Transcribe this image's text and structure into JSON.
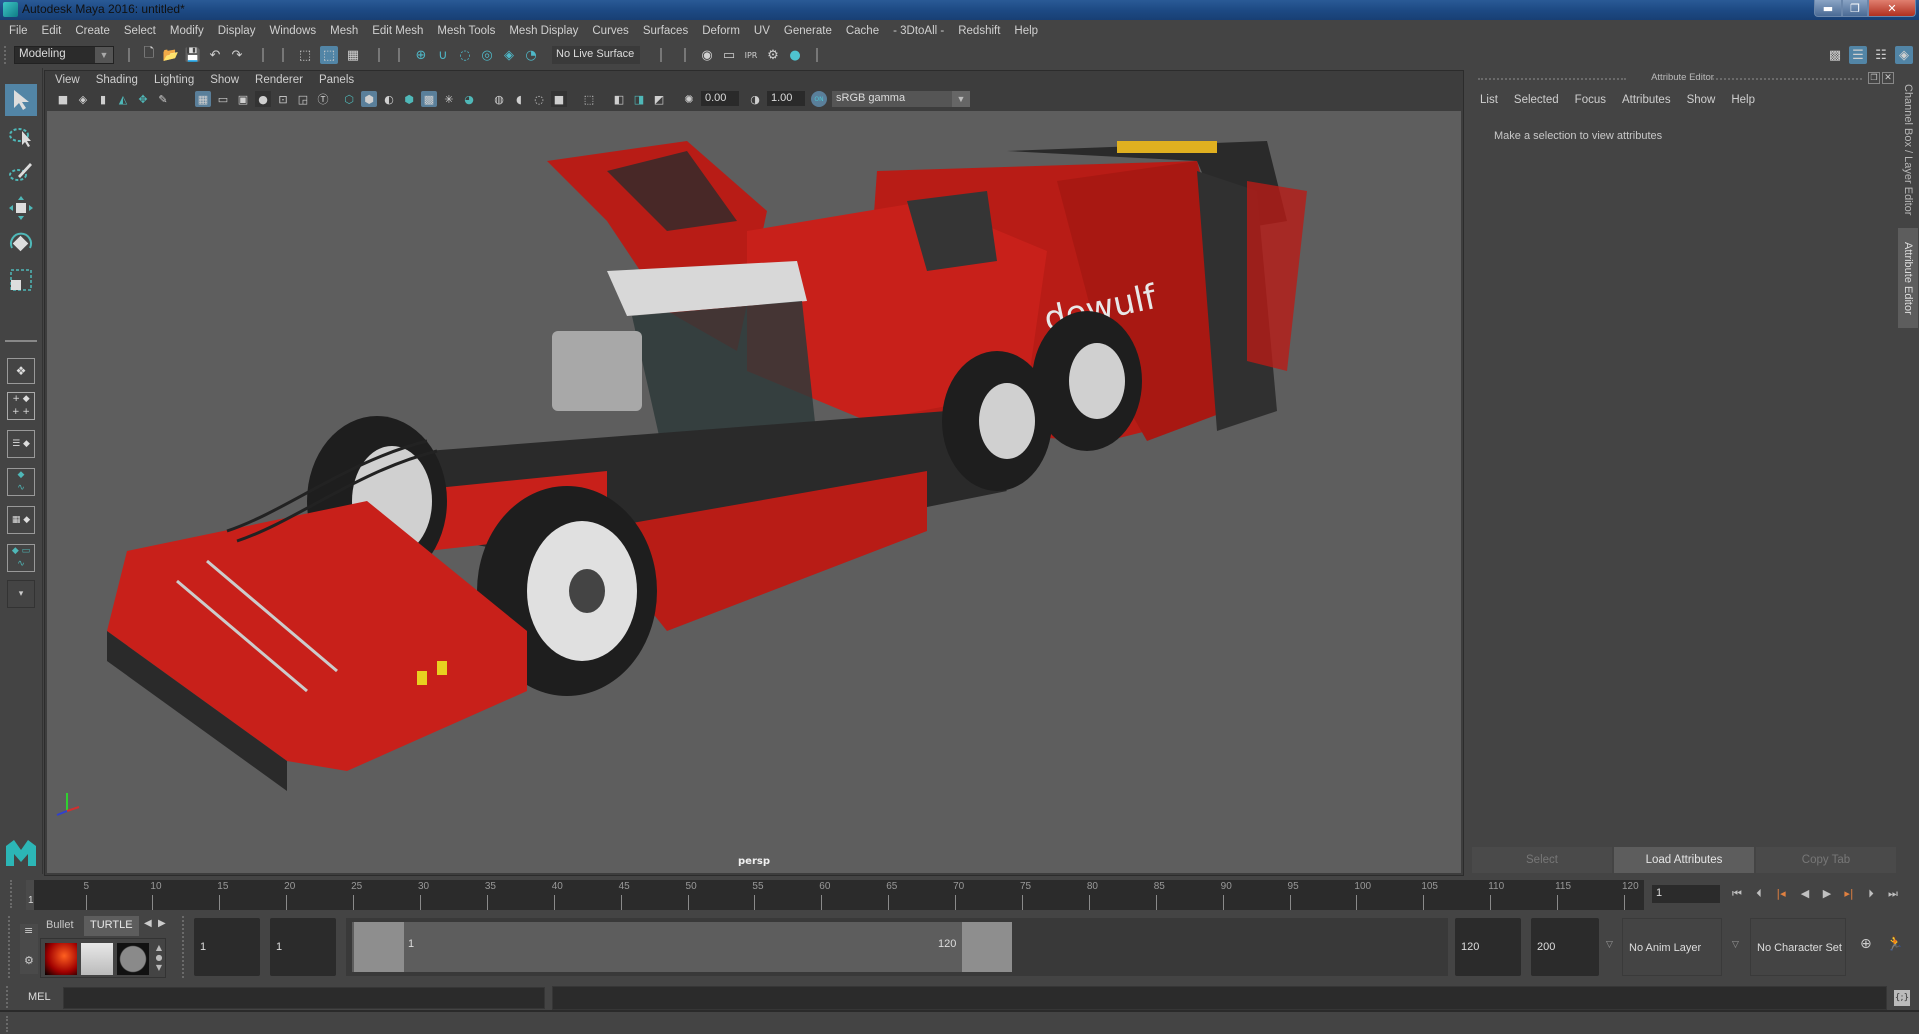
{
  "window": {
    "title": "Autodesk Maya 2016: untitled*",
    "controls": [
      "minimize",
      "maximize",
      "close"
    ]
  },
  "menubar": {
    "items": [
      "File",
      "Edit",
      "Create",
      "Select",
      "Modify",
      "Display",
      "Windows",
      "Mesh",
      "Edit Mesh",
      "Mesh Tools",
      "Mesh Display",
      "Curves",
      "Surfaces",
      "Deform",
      "UV",
      "Generate",
      "Cache",
      "- 3DtoAll -",
      "Redshift",
      "Help"
    ]
  },
  "statusline": {
    "mode": "Modeling",
    "live_surface": "No Live Surface"
  },
  "viewport": {
    "menu": [
      "View",
      "Shading",
      "Lighting",
      "Show",
      "Renderer",
      "Panels"
    ],
    "exposure": "0.00",
    "gamma": "1.00",
    "color_management": "ON",
    "color_space": "sRGB gamma",
    "camera": "persp",
    "scene": {
      "subject": "Red dewulf self-propelled beet harvester",
      "brand_text": "dewulf",
      "colors": {
        "body": "#c8201a",
        "dark": "#2a2a2a",
        "cab_roof": "#d8d8d8",
        "background": "#5e5e5e"
      }
    }
  },
  "attribute_editor": {
    "title": "Attribute Editor",
    "menu": [
      "List",
      "Selected",
      "Focus",
      "Attributes",
      "Show",
      "Help"
    ],
    "message": "Make a selection to view attributes",
    "buttons": {
      "select": "Select",
      "load": "Load Attributes",
      "copy": "Copy Tab"
    }
  },
  "side_tabs": {
    "channel_box": "Channel Box / Layer Editor",
    "attribute_editor": "Attribute Editor"
  },
  "timeline": {
    "start": 1,
    "end": 120,
    "current_frame_label": "1",
    "ticks": [
      5,
      10,
      15,
      20,
      25,
      30,
      35,
      40,
      45,
      50,
      55,
      60,
      65,
      70,
      75,
      80,
      85,
      90,
      95,
      100,
      105,
      110,
      115,
      120
    ],
    "current_frame_field": "1"
  },
  "range": {
    "shelf_tabs": [
      "Bullet",
      "TURTLE"
    ],
    "start_field": "1",
    "playback_start": "1",
    "range_start_label": "1",
    "range_end_label": "120",
    "playback_end": "120",
    "end_field": "200",
    "anim_layer": "No Anim Layer",
    "character_set": "No Character Set"
  },
  "command_line": {
    "language": "MEL"
  },
  "accent": "#5285a6"
}
